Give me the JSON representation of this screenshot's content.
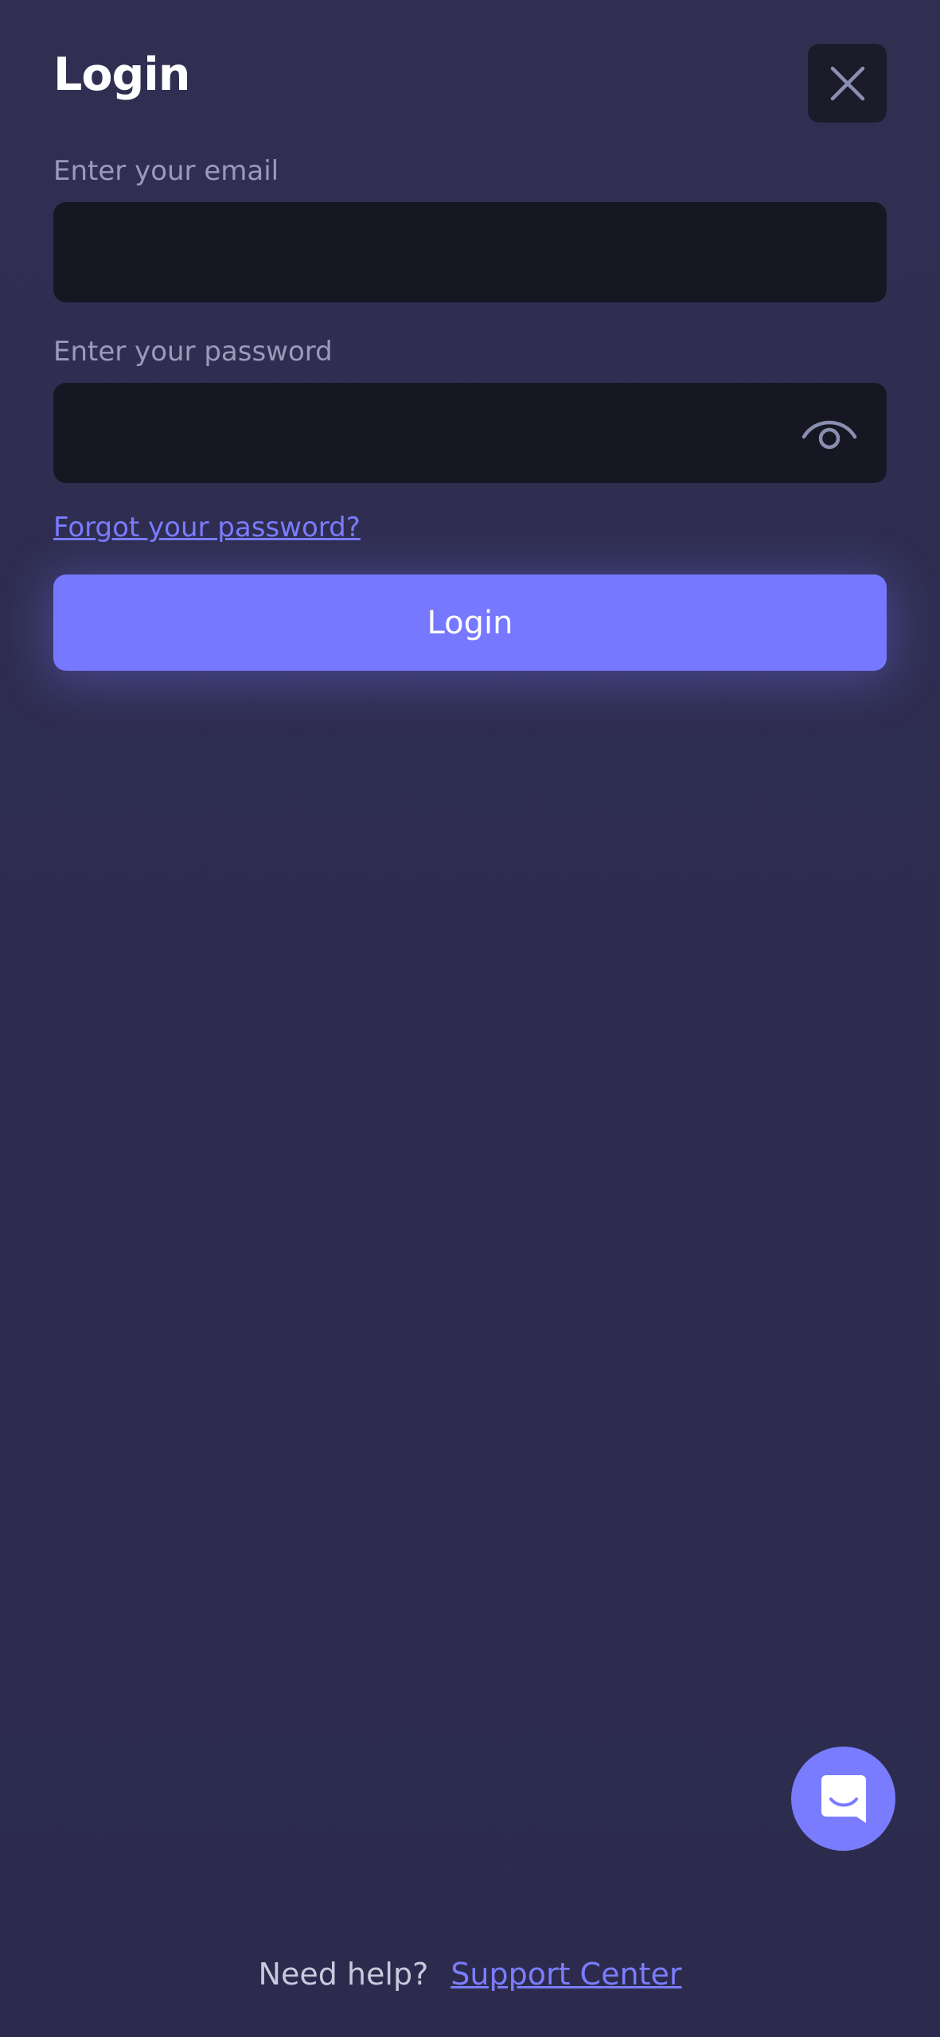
{
  "header": {
    "title": "Login"
  },
  "form": {
    "email_label": "Enter your email",
    "email_value": "",
    "password_label": "Enter your password",
    "password_value": "",
    "forgot_link": "Forgot your password?",
    "login_button": "Login"
  },
  "footer": {
    "need_help": "Need help?",
    "support_link": "Support Center"
  },
  "icons": {
    "close": "close-icon",
    "eye": "eye-icon",
    "chat": "chat-icon"
  },
  "colors": {
    "background": "#2e2d4f",
    "input": "#161722",
    "accent": "#7678ff",
    "link": "#7b7cff"
  }
}
